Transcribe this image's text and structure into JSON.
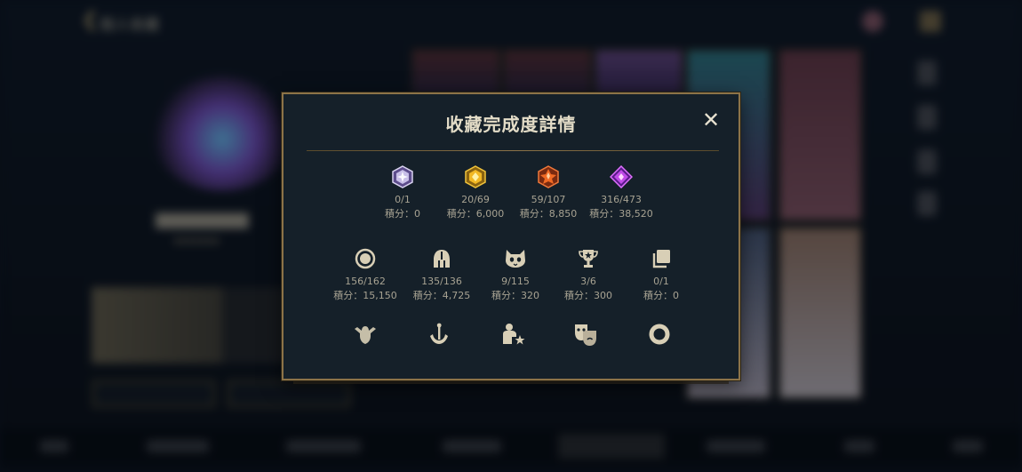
{
  "background": {
    "title": "個人收藏"
  },
  "modal": {
    "title": "收藏完成度詳情",
    "close_symbol": "✕",
    "rarity_row": [
      {
        "icon": "white-crystal-icon",
        "count": "0/1",
        "score": "積分：0"
      },
      {
        "icon": "gold-gem-icon",
        "count": "20/69",
        "score": "積分：6,000"
      },
      {
        "icon": "orange-gem-icon",
        "count": "59/107",
        "score": "積分：8,850"
      },
      {
        "icon": "purple-gem-icon",
        "count": "316/473",
        "score": "積分：38,520"
      }
    ],
    "category_row": [
      {
        "icon": "ring-icon",
        "count": "156/162",
        "score": "積分：15,150"
      },
      {
        "icon": "helmet-icon",
        "count": "135/136",
        "score": "積分：4,725"
      },
      {
        "icon": "cat-face-icon",
        "count": "9/115",
        "score": "積分：320"
      },
      {
        "icon": "trophy-icon",
        "count": "3/6",
        "score": "積分：300"
      },
      {
        "icon": "copies-icon",
        "count": "0/1",
        "score": "積分：0"
      }
    ],
    "bottom_icons": [
      "winged-emblem-icon",
      "sword-emblem-icon",
      "figure-star-icon",
      "masks-icon",
      "donut-ring-icon"
    ]
  },
  "colors": {
    "gold_border": "#8c7348",
    "modal_bg": "#152029",
    "icon_tan": "#d8cfb6"
  }
}
